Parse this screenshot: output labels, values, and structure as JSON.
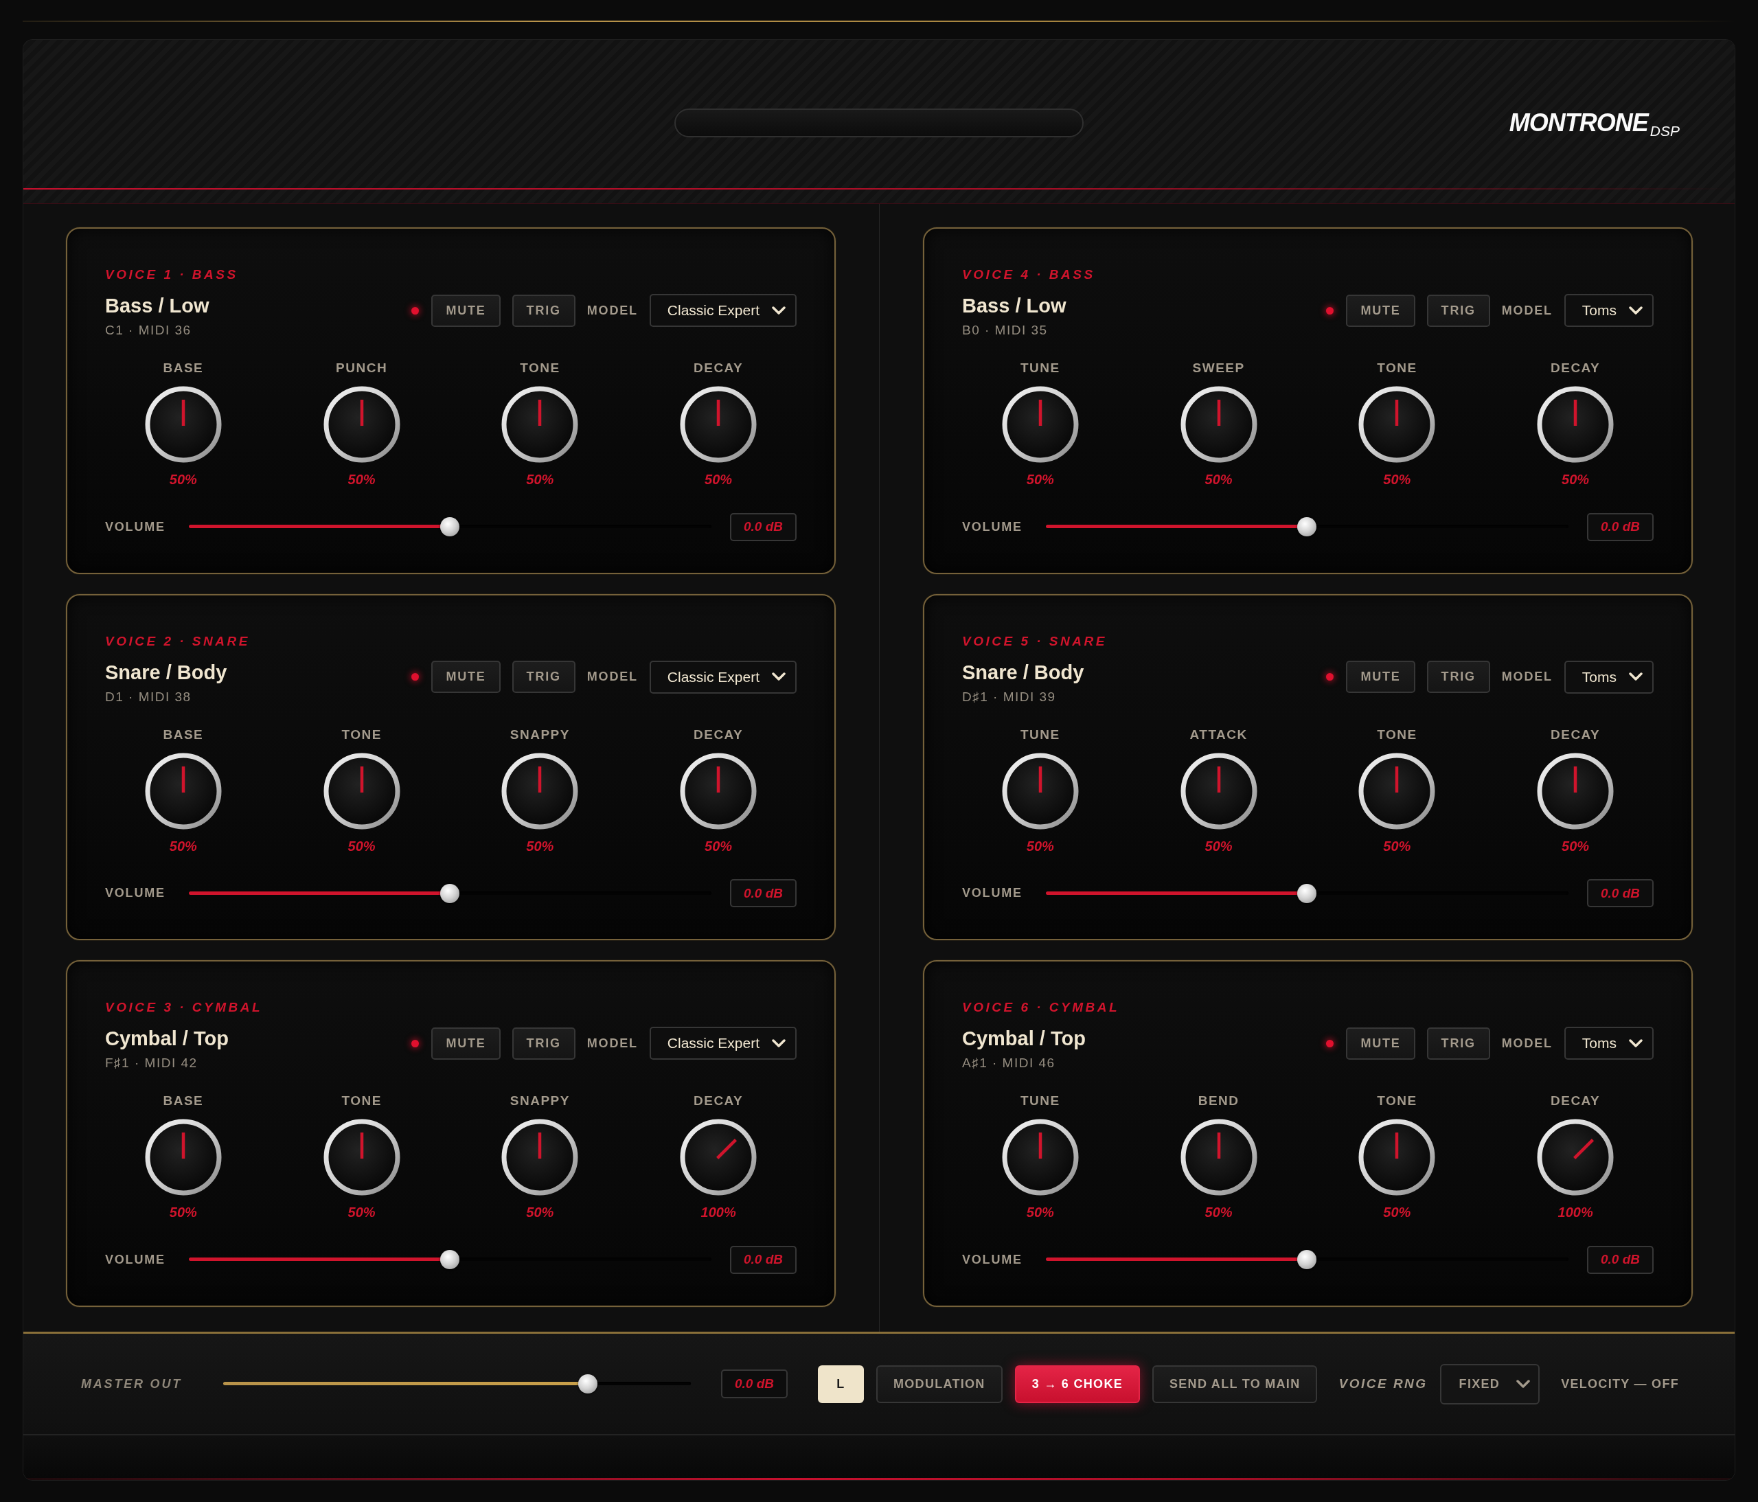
{
  "header": {
    "logo": "MONTRONE",
    "logo_suffix": "DSP"
  },
  "columns": [
    {
      "voices": [
        {
          "tag": "VOICE 1 · BASS",
          "title": "Bass / Low",
          "note": "C1 · MIDI 36",
          "led_on": true,
          "buttons": [
            "MUTE",
            "TRIG"
          ],
          "model_label": "MODEL",
          "model": "Classic Expert",
          "knobs": [
            {
              "label": "BASE",
              "at_max": false,
              "reading": "50%"
            },
            {
              "label": "PUNCH",
              "at_max": false,
              "reading": "50%"
            },
            {
              "label": "TONE",
              "at_max": false,
              "reading": "50%"
            },
            {
              "label": "DECAY",
              "at_max": false,
              "reading": "50%"
            }
          ],
          "volume": {
            "label": "VOLUME",
            "level": 0.5,
            "reading": "0.0 dB"
          }
        },
        {
          "tag": "VOICE 2 · SNARE",
          "title": "Snare / Body",
          "note": "D1 · MIDI 38",
          "led_on": true,
          "buttons": [
            "MUTE",
            "TRIG"
          ],
          "model_label": "MODEL",
          "model": "Classic Expert",
          "knobs": [
            {
              "label": "BASE",
              "at_max": false,
              "reading": "50%"
            },
            {
              "label": "TONE",
              "at_max": false,
              "reading": "50%"
            },
            {
              "label": "SNAPPY",
              "at_max": false,
              "reading": "50%"
            },
            {
              "label": "DECAY",
              "at_max": false,
              "reading": "50%"
            }
          ],
          "volume": {
            "label": "VOLUME",
            "level": 0.5,
            "reading": "0.0 dB"
          }
        },
        {
          "tag": "VOICE 3 · CYMBAL",
          "title": "Cymbal / Top",
          "note": "F♯1 · MIDI 42",
          "led_on": true,
          "buttons": [
            "MUTE",
            "TRIG"
          ],
          "model_label": "MODEL",
          "model": "Classic Expert",
          "knobs": [
            {
              "label": "BASE",
              "at_max": false,
              "reading": "50%"
            },
            {
              "label": "TONE",
              "at_max": false,
              "reading": "50%"
            },
            {
              "label": "SNAPPY",
              "at_max": false,
              "reading": "50%"
            },
            {
              "label": "DECAY",
              "at_max": true,
              "reading": "100%"
            }
          ],
          "volume": {
            "label": "VOLUME",
            "level": 0.5,
            "reading": "0.0 dB"
          }
        }
      ]
    },
    {
      "voices": [
        {
          "tag": "VOICE 4 · BASS",
          "title": "Bass / Low",
          "note": "B0 · MIDI 35",
          "led_on": true,
          "buttons": [
            "MUTE",
            "TRIG"
          ],
          "model_label": "MODEL",
          "model": "Toms",
          "knobs": [
            {
              "label": "TUNE",
              "at_max": false,
              "reading": "50%"
            },
            {
              "label": "SWEEP",
              "at_max": false,
              "reading": "50%"
            },
            {
              "label": "TONE",
              "at_max": false,
              "reading": "50%"
            },
            {
              "label": "DECAY",
              "at_max": false,
              "reading": "50%"
            }
          ],
          "volume": {
            "label": "VOLUME",
            "level": 0.5,
            "reading": "0.0 dB"
          }
        },
        {
          "tag": "VOICE 5 · SNARE",
          "title": "Snare / Body",
          "note": "D♯1 · MIDI 39",
          "led_on": true,
          "buttons": [
            "MUTE",
            "TRIG"
          ],
          "model_label": "MODEL",
          "model": "Toms",
          "knobs": [
            {
              "label": "TUNE",
              "at_max": false,
              "reading": "50%"
            },
            {
              "label": "ATTACK",
              "at_max": false,
              "reading": "50%"
            },
            {
              "label": "TONE",
              "at_max": false,
              "reading": "50%"
            },
            {
              "label": "DECAY",
              "at_max": false,
              "reading": "50%"
            }
          ],
          "volume": {
            "label": "VOLUME",
            "level": 0.5,
            "reading": "0.0 dB"
          }
        },
        {
          "tag": "VOICE 6 · CYMBAL",
          "title": "Cymbal / Top",
          "note": "A♯1 · MIDI 46",
          "led_on": true,
          "buttons": [
            "MUTE",
            "TRIG"
          ],
          "model_label": "MODEL",
          "model": "Toms",
          "knobs": [
            {
              "label": "TUNE",
              "at_max": false,
              "reading": "50%"
            },
            {
              "label": "BEND",
              "at_max": false,
              "reading": "50%"
            },
            {
              "label": "TONE",
              "at_max": false,
              "reading": "50%"
            },
            {
              "label": "DECAY",
              "at_max": true,
              "reading": "100%"
            }
          ],
          "volume": {
            "label": "VOLUME",
            "level": 0.5,
            "reading": "0.0 dB"
          }
        }
      ]
    }
  ],
  "footer": {
    "master": {
      "label": "MASTER OUT",
      "level": 0.78,
      "reading": "0.0 dB"
    },
    "buttons": [
      {
        "label": "L",
        "kind": "toggle",
        "on": true
      },
      {
        "label": "MODULATION",
        "kind": "toggle",
        "on": false
      },
      {
        "label": "3 → 6 CHOKE",
        "kind": "choke",
        "on": true
      },
      {
        "label": "SEND ALL TO MAIN",
        "kind": "action",
        "on": false
      }
    ],
    "voice_rng": {
      "label": "VOICE RNG",
      "value": "FIXED"
    },
    "velocity": "VELOCITY — OFF"
  }
}
